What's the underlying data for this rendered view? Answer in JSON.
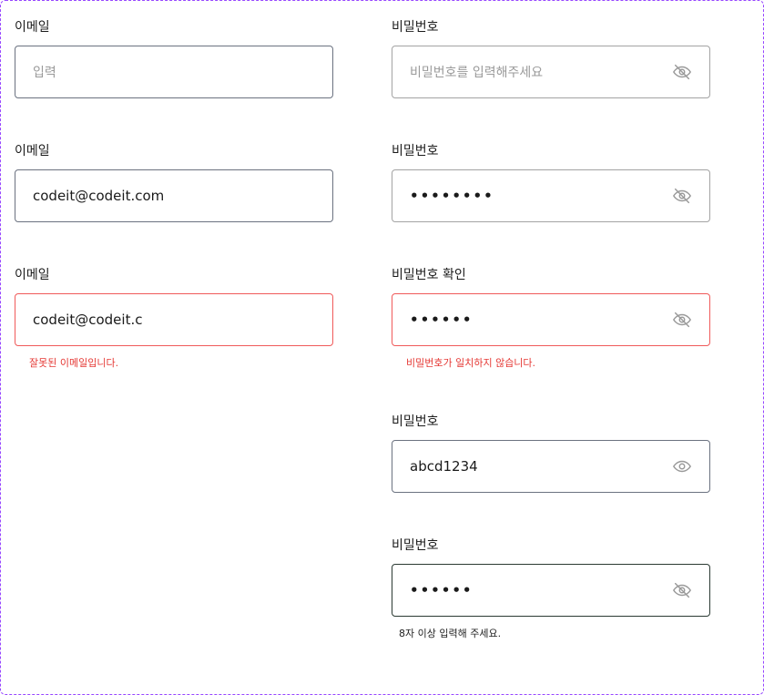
{
  "fields": {
    "email1": {
      "label": "이메일",
      "placeholder": "입력"
    },
    "password1": {
      "label": "비밀번호",
      "placeholder": "비밀번호를 입력해주세요"
    },
    "email2": {
      "label": "이메일",
      "value": "codeit@codeit.com"
    },
    "password2": {
      "label": "비밀번호",
      "masked": "••••••••"
    },
    "email3": {
      "label": "이메일",
      "value": "codeit@codeit.c",
      "error": "잘못된 이메일입니다."
    },
    "password_confirm": {
      "label": "비밀번호 확인",
      "masked": "••••••",
      "error": "비밀번호가 일치하지 않습니다."
    },
    "password_visible": {
      "label": "비밀번호",
      "value": "abcd1234"
    },
    "password_focus": {
      "label": "비밀번호",
      "masked": "••••••",
      "hint": "8자 이상 입력해 주세요."
    }
  },
  "icons": {
    "hidden": "eye-off-icon",
    "visible": "eye-icon"
  },
  "colors": {
    "frame": "#9747ff",
    "error": "#e53935",
    "border_default": "#6b7280",
    "border_focus": "#2b3a33",
    "icon": "#9a9a9a"
  }
}
